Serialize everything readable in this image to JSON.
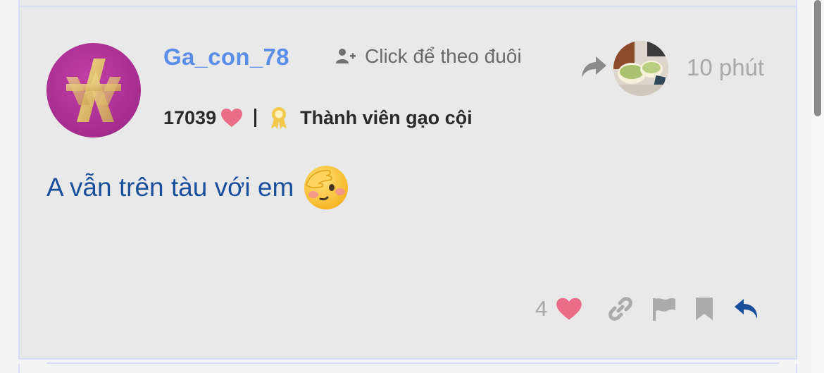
{
  "post": {
    "username": "Ga_con_78",
    "follow_label": "Click để theo đuôi",
    "points": "17039",
    "rank": "Thành viên gạo cội",
    "time": "10 phút",
    "message": "A vẫn trên tàu với em",
    "like_count": "4"
  },
  "icons": {
    "avatar": "logo-avatar",
    "follow": "add-user-icon",
    "points": "heart-icon",
    "rank": "medal-icon",
    "reply_to": "share-arrow-icon",
    "emoji": "face-peeking-emoji",
    "like": "heart-icon",
    "link": "link-icon",
    "report": "flag-icon",
    "bookmark": "bookmark-icon",
    "reply": "reply-icon"
  },
  "colors": {
    "username": "#5a8ee8",
    "message": "#1a4f9c",
    "heart": "#e96d86",
    "reply": "#1a4f9c",
    "muted": "#a8a8a8"
  }
}
